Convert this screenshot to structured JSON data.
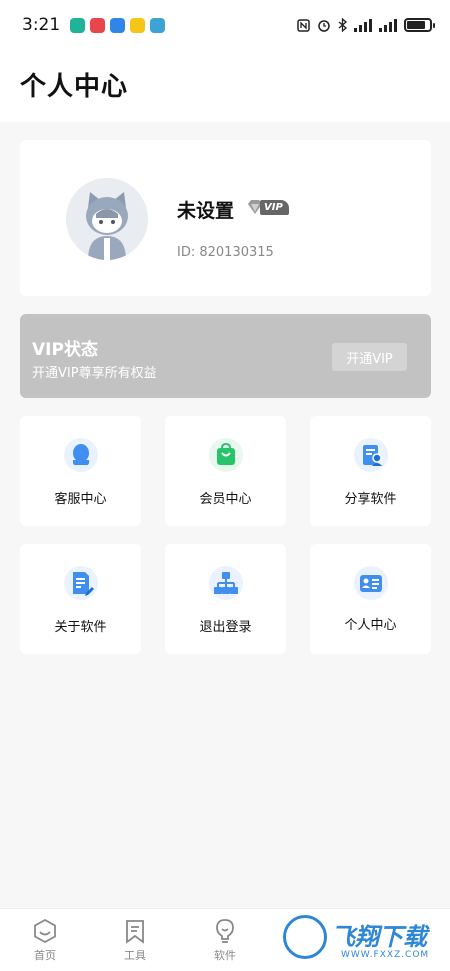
{
  "status_bar": {
    "time": "3:21",
    "apps": [
      "#1fb39a",
      "#e8464a",
      "#2f86e6",
      "#f5c518",
      "#3fa2d5"
    ],
    "battery_percent": 80
  },
  "header": {
    "title": "个人中心"
  },
  "profile": {
    "nickname": "未设置",
    "vip_tag": "VIP",
    "user_id": "ID: 820130315"
  },
  "vip_card": {
    "title": "VIP状态",
    "subtitle": "开通VIP尊享所有权益",
    "button": "开通VIP"
  },
  "grid": [
    {
      "label": "客服中心",
      "icon": "customer-service-icon",
      "color": "#3f8ef0"
    },
    {
      "label": "会员中心",
      "icon": "shopping-bag-icon",
      "color": "#27c46a"
    },
    {
      "label": "分享软件",
      "icon": "share-document-icon",
      "color": "#3f8ef0"
    },
    {
      "label": "关于软件",
      "icon": "document-edit-icon",
      "color": "#3f8ef0"
    },
    {
      "label": "退出登录",
      "icon": "org-chart-icon",
      "color": "#3f8ef0"
    },
    {
      "label": "个人中心",
      "icon": "id-card-icon",
      "color": "#3f8ef0"
    }
  ],
  "tab_bar": [
    {
      "label": "首页",
      "icon": "home-icon"
    },
    {
      "label": "工具",
      "icon": "bookmark-icon"
    },
    {
      "label": "软件",
      "icon": "lightbulb-icon"
    },
    {
      "label": "",
      "icon": "partial-icon"
    },
    {
      "label": "",
      "icon": "partial-icon"
    }
  ],
  "watermark": {
    "text": "飞翔下载",
    "sub": "WWW.FXXZ.COM"
  }
}
